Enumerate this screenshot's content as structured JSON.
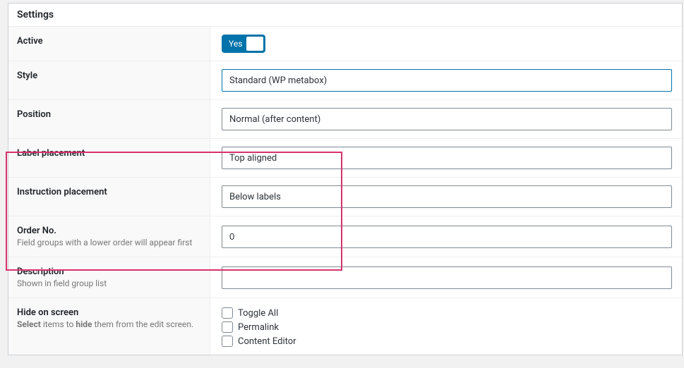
{
  "panel": {
    "title": "Settings"
  },
  "rows": {
    "active": {
      "label": "Active",
      "toggle_label": "Yes"
    },
    "style": {
      "label": "Style",
      "value": "Standard (WP metabox)"
    },
    "position": {
      "label": "Position",
      "value": "Normal (after content)"
    },
    "label_placement": {
      "label": "Label placement",
      "value": "Top aligned"
    },
    "instruction_placement": {
      "label": "Instruction placement",
      "value": "Below labels"
    },
    "order_no": {
      "label": "Order No.",
      "desc": "Field groups with a lower order will appear first",
      "value": "0"
    },
    "description": {
      "label": "Description",
      "desc": "Shown in field group list",
      "value": ""
    },
    "hide_on_screen": {
      "label": "Hide on screen",
      "desc_prefix": "Select",
      "desc_mid": " items to ",
      "desc_bold": "hide",
      "desc_suffix": " them from the edit screen.",
      "items": [
        "Toggle All",
        "Permalink",
        "Content Editor"
      ]
    }
  }
}
